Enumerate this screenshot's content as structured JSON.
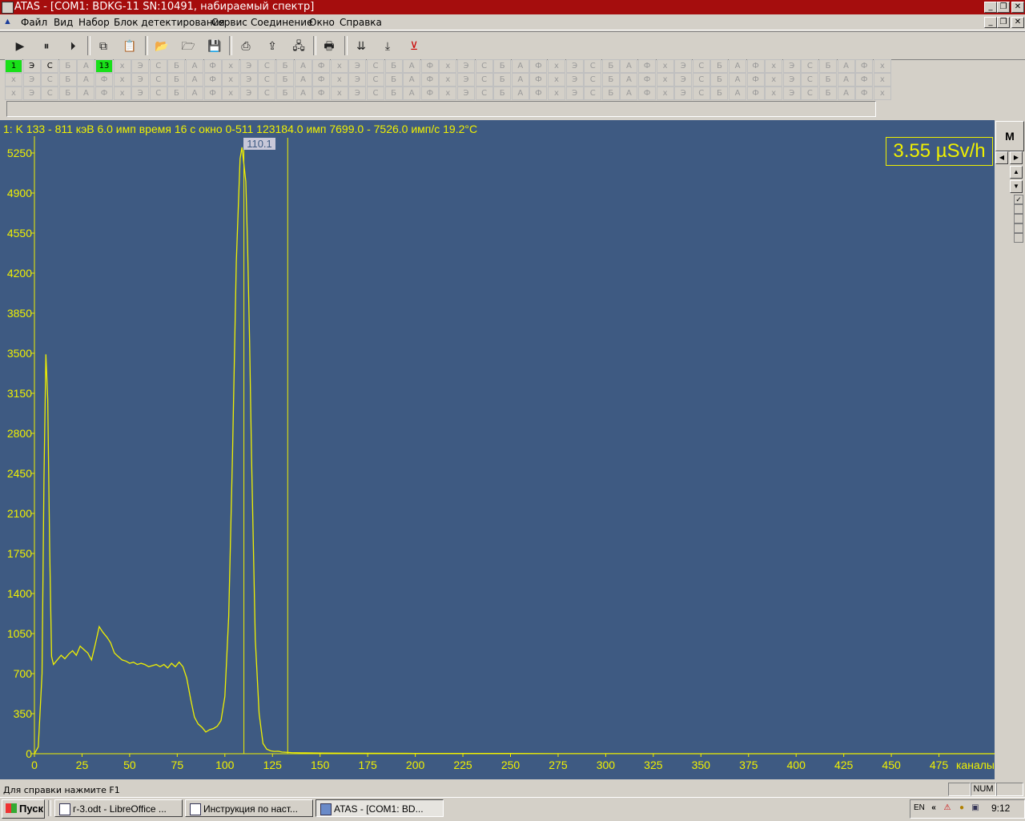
{
  "window": {
    "title": "ATAS  - [COM1: BDKG-11 SN:10491, набираемый спектр]",
    "controls": [
      "_",
      "❐",
      "✕"
    ]
  },
  "menu": [
    "Файл",
    "Вид",
    "Набор",
    "Блок детектирования",
    "Сервис",
    "Соединение",
    "Окно",
    "Справка"
  ],
  "toolbar": {
    "icons": [
      "play-icon",
      "pause-icon",
      "step-play-icon",
      "copy-icon",
      "paste-icon",
      "open-folder-icon",
      "open-file-icon",
      "save-icon",
      "printer-setup-icon",
      "export-icon",
      "network-icon",
      "print-icon",
      "marker-pair-icon",
      "marker-down-icon",
      "marker-remove-icon"
    ]
  },
  "buffers": {
    "row_pattern": [
      "х",
      "Э",
      "С",
      "Б",
      "А",
      "Ф"
    ],
    "first_row_overrides": {
      "0": "1",
      "5": "13"
    },
    "active_cells": [
      0,
      5
    ],
    "dark_cells": [
      1,
      2
    ],
    "cols": 49,
    "rows": 3
  },
  "spectrum": {
    "info_line": "1: K 133 - 811 кэВ  6.0 имп   время 16 с    окно 0-511 123184.0 имп 7699.0 - 7526.0 имп/с   19.2°C",
    "dose_rate": "3.55 µSv/h",
    "cursor_label": "110.1",
    "m_button": "M"
  },
  "chart_data": {
    "type": "line",
    "xlabel": "каналы",
    "ylabel": "",
    "xlim": [
      0,
      511
    ],
    "ylim": [
      0,
      5350
    ],
    "x_ticks": [
      0,
      25,
      50,
      75,
      100,
      125,
      150,
      175,
      200,
      225,
      250,
      275,
      300,
      325,
      350,
      375,
      400,
      425,
      450,
      475
    ],
    "y_ticks": [
      0,
      350,
      700,
      1050,
      1400,
      1750,
      2100,
      2450,
      2800,
      3150,
      3500,
      3850,
      4200,
      4550,
      4900,
      5250
    ],
    "markers": [
      110,
      133
    ],
    "colors": {
      "line": "#f0f000",
      "background": "#3e5a82"
    },
    "series": [
      {
        "x": [
          0,
          2,
          4,
          5,
          6,
          7,
          8,
          9,
          10,
          12,
          14,
          16,
          18,
          20,
          22,
          24,
          26,
          28,
          30,
          32,
          34,
          36,
          38,
          40,
          42,
          44,
          46,
          48,
          50,
          52,
          54,
          56,
          58,
          60,
          62,
          64,
          66,
          68,
          70,
          72,
          74,
          76,
          78,
          80,
          82,
          84,
          86,
          88,
          90,
          92,
          94,
          96,
          98,
          100,
          102,
          104,
          106,
          108,
          109,
          110,
          111,
          112,
          113,
          114,
          116,
          118,
          120,
          122,
          124,
          126,
          128,
          130,
          135,
          140,
          150,
          160,
          175,
          200,
          225,
          240,
          250,
          275,
          300,
          350,
          400,
          450,
          500,
          511
        ],
        "y": [
          0,
          60,
          700,
          2400,
          3490,
          3100,
          1800,
          850,
          780,
          820,
          860,
          830,
          870,
          900,
          860,
          940,
          910,
          880,
          820,
          960,
          1110,
          1060,
          1020,
          970,
          880,
          850,
          820,
          810,
          790,
          800,
          780,
          790,
          780,
          760,
          770,
          780,
          760,
          780,
          750,
          790,
          760,
          800,
          760,
          660,
          480,
          320,
          260,
          230,
          190,
          210,
          220,
          240,
          290,
          500,
          1200,
          2600,
          4300,
          5200,
          5300,
          5150,
          5000,
          4400,
          3600,
          2600,
          1000,
          350,
          90,
          40,
          25,
          20,
          22,
          15,
          10,
          8,
          6,
          5,
          4,
          3,
          3,
          2,
          2,
          1,
          1,
          0,
          0,
          0,
          0,
          0
        ]
      }
    ]
  },
  "status": {
    "help": "Для справки нажмите F1",
    "num": "NUM"
  },
  "taskbar": {
    "start": "Пуск",
    "tasks": [
      "г-3.odt - LibreOffice ...",
      "Инструкция по наст...",
      "ATAS  - [COM1: BD..."
    ],
    "tray_lang": "EN",
    "clock": "9:12"
  }
}
